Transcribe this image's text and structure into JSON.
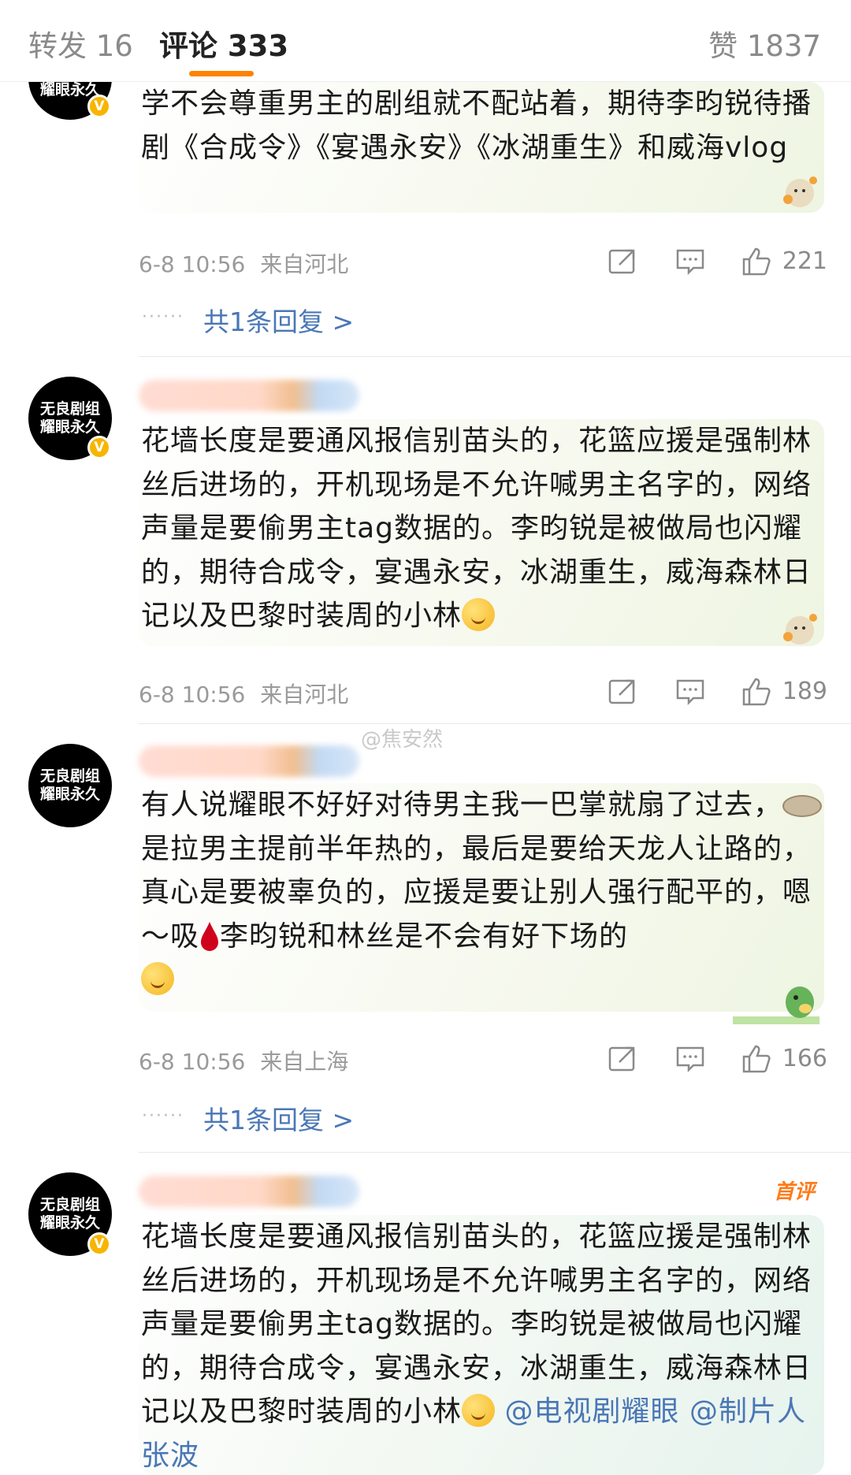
{
  "tabs": {
    "repost": "转发 16",
    "comment": "评论 333",
    "like": "赞 1837"
  },
  "avatar_text": {
    "line1": "无良剧组",
    "line2": "耀眼永久",
    "top_partial": "耀眼永久"
  },
  "comments": [
    {
      "text": "学不会尊重男主的剧组就不配站着，期待李昀锐待播剧《合成令》《宴遇永安》《冰湖重生》和威海vlog",
      "time": "6-8 10:56",
      "location": "来自河北",
      "likes": "221",
      "replies": "共1条回复 >"
    },
    {
      "text": "花墙长度是要通风报信别苗头的，花篮应援是强制林丝后进场的，开机现场是不允许喊男主名字的，网络声量是要偷男主tag数据的。李昀锐是被做局也闪耀的，期待合成令，宴遇永安，冰湖重生，威海森林日记以及巴黎时装周的小林",
      "time": "6-8 10:56",
      "location": "来自河北",
      "likes": "189"
    },
    {
      "text_part1": "有人说耀眼不好好对待男主我一巴掌就扇了过去，",
      "text_part2": "是拉男主提前半年热的，最后是要给天龙人让路的，真心是要被辜负的，应援是要让别人强行配平的，嗯～吸",
      "text_part3": "李昀锐和林丝是不会有好下场的",
      "time": "6-8 10:56",
      "location": "来自上海",
      "likes": "166",
      "replies": "共1条回复 >"
    },
    {
      "text": "花墙长度是要通风报信别苗头的，花篮应援是强制林丝后进场的，开机现场是不允许喊男主名字的，网络声量是要偷男主tag数据的。李昀锐是被做局也闪耀的，期待合成令，宴遇永安，冰湖重生，威海森林日记以及巴黎时装周的小林",
      "mention1": "@电视剧耀眼",
      "mention2": "@制片人张波",
      "badge": "首评"
    }
  ],
  "watermark": "@焦安然",
  "colors": {
    "accent": "#ff8200",
    "link": "#4a77b5",
    "verified": "#f7b500"
  }
}
